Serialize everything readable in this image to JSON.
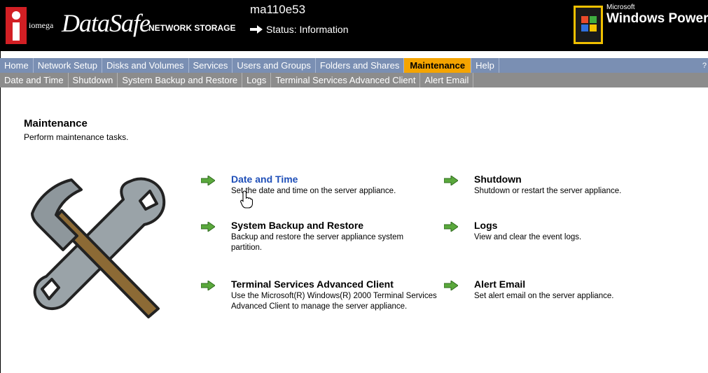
{
  "header": {
    "brand_small": "iomega",
    "brand_name": "DataSafe",
    "brand_product": "NETWORK STORAGE",
    "server_name": "ma110e53",
    "status_text": "Status: Information",
    "ms_label": "Microsoft",
    "windows_powered": "Windows Powered"
  },
  "nav": {
    "primary": [
      {
        "label": "Home"
      },
      {
        "label": "Network Setup"
      },
      {
        "label": "Disks and Volumes"
      },
      {
        "label": "Services"
      },
      {
        "label": "Users and Groups"
      },
      {
        "label": "Folders and Shares"
      },
      {
        "label": "Maintenance",
        "active": true
      },
      {
        "label": "Help"
      }
    ],
    "primary_edge": "?",
    "secondary": [
      {
        "label": "Date and Time"
      },
      {
        "label": "Shutdown"
      },
      {
        "label": "System Backup and Restore"
      },
      {
        "label": "Logs"
      },
      {
        "label": "Terminal Services Advanced Client"
      },
      {
        "label": "Alert Email"
      }
    ]
  },
  "page": {
    "title": "Maintenance",
    "description": "Perform maintenance tasks."
  },
  "tasks": [
    {
      "title": "Date and Time",
      "desc": "Set the date and time on the server appliance.",
      "hover": true
    },
    {
      "title": "Shutdown",
      "desc": "Shutdown or restart the server appliance."
    },
    {
      "title": "System Backup and Restore",
      "desc_lines": [
        "Backup and restore the server appliance system",
        "partition."
      ]
    },
    {
      "title": "Logs",
      "desc": "View and clear the event logs."
    },
    {
      "title": "Terminal Services Advanced Client",
      "desc_lines": [
        "Use the Microsoft(R) Windows(R) 2000 Terminal Services",
        "Advanced Client to manage the server appliance."
      ]
    },
    {
      "title": "Alert Email",
      "desc": "Set alert email on the server appliance."
    }
  ],
  "colors": {
    "nav_primary": "#7a8fb3",
    "nav_active": "#f4a400",
    "nav_secondary": "#8c8c8c",
    "link": "#1f4fb8",
    "go_arrow": "#5aa83c"
  }
}
